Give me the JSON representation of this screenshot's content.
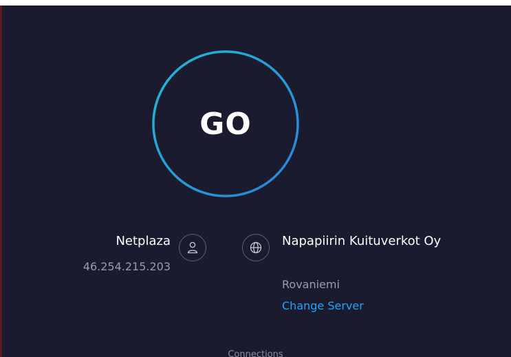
{
  "go_button": {
    "label": "GO",
    "ring_color_start": "#1fbcd4",
    "ring_color_end": "#2c7fd8"
  },
  "provider": {
    "name": "Netplaza",
    "ip": "46.254.215.203",
    "icon": "user-icon"
  },
  "server": {
    "name": "Napapiirin Kuituverkot Oy",
    "location": "Rovaniemi",
    "change_label": "Change Server",
    "icon": "globe-icon"
  },
  "footer": {
    "connections_label": "Connections"
  },
  "colors": {
    "background": "#1a1b2e",
    "link": "#1ea5ff",
    "muted_text": "#9a9bad"
  }
}
